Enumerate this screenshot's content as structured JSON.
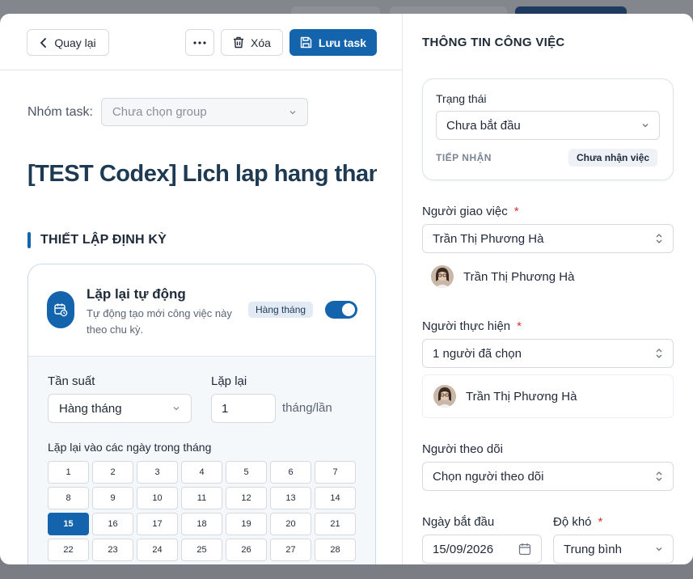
{
  "toolbar": {
    "back_label": "Quay lại",
    "delete_label": "Xóa",
    "save_label": "Lưu task"
  },
  "task": {
    "group_label": "Nhóm task:",
    "group_placeholder": "Chưa chọn group",
    "title": "[TEST Codex] Lich lap hang thang"
  },
  "recurrence": {
    "section_title": "THIẾT LẬP ĐỊNH KỲ",
    "auto_title": "Lặp lại tự động",
    "auto_desc": "Tự động tạo mới công việc này theo chu kỳ.",
    "frequency_tag": "Hàng tháng",
    "enabled": true,
    "frequency_label": "Tần suất",
    "frequency_value": "Hàng tháng",
    "repeat_label": "Lặp lại",
    "repeat_value": "1",
    "repeat_unit": "tháng/lần",
    "days_label": "Lặp lại vào các ngày trong tháng",
    "days": [
      "1",
      "2",
      "3",
      "4",
      "5",
      "6",
      "7",
      "8",
      "9",
      "10",
      "11",
      "12",
      "13",
      "14",
      "15",
      "16",
      "17",
      "18",
      "19",
      "20",
      "21",
      "22",
      "23",
      "24",
      "25",
      "26",
      "27",
      "28"
    ],
    "selected_day": "15"
  },
  "info": {
    "title": "THÔNG TIN CÔNG VIỆC",
    "status_label": "Trạng thái",
    "status_value": "Chưa bắt đầu",
    "receive_label": "TIẾP NHẬN",
    "receive_value": "Chưa nhận việc",
    "assigner_label": "Người giao việc",
    "assigner_value": "Trần Thị Phương Hà",
    "assigner_person": "Trần Thị Phương Hà",
    "assignee_label": "Người thực hiện",
    "assignee_value": "1 người đã chọn",
    "assignee_person": "Trần Thị Phương Hà",
    "watcher_label": "Người theo dõi",
    "watcher_value": "Chọn người theo dõi",
    "start_label": "Ngày bắt đầu",
    "start_value": "15/09/2026",
    "difficulty_label": "Độ khó",
    "difficulty_value": "Trung bình",
    "required_mark": "*"
  },
  "colors": {
    "primary": "#1363ad",
    "title": "#1e3a52",
    "required": "#d9312b"
  },
  "icons": [
    "chevron-left-icon",
    "more-icon",
    "trash-icon",
    "save-icon",
    "calendar-repeat-icon",
    "chevron-down-icon",
    "updown-icon",
    "calendar-icon"
  ]
}
